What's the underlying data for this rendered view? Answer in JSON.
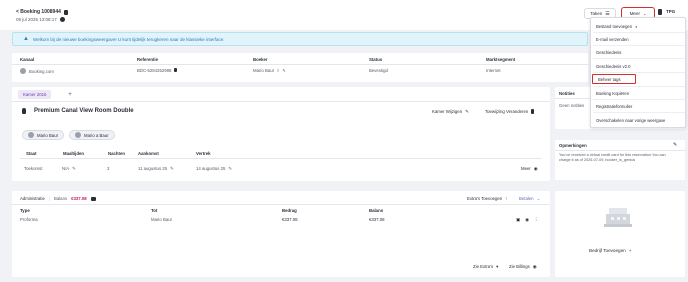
{
  "header": {
    "title": "< Boeking 1008944",
    "subtitle": "09 jul 2025 13:08:17",
    "taken_label": "Taken",
    "meer_label": "Meer",
    "tpg_label": "TPG"
  },
  "banner": {
    "text": "Welkom bij de nieuwe boekingsweergave! U kunt tijdelijk terugkeren naar de klassieke interface."
  },
  "overview": {
    "headers": [
      "Kanaal",
      "Referentie",
      "Boeker",
      "Status",
      "Marktsegment"
    ],
    "row": {
      "kanaal": "Booking.com",
      "referentie": "BDC-5284352988",
      "boeker": "Mario Baur",
      "status": "Bevestigd",
      "marktsegment": "Internet"
    }
  },
  "room": {
    "tab_label": "Kamer 2016",
    "add_tab": "+",
    "name": "Premium Canal View Room Double",
    "kamer_wijzigen": "Kamer Wijzigen",
    "toewijzing": "Toewijzing Veranderen",
    "guests": [
      "Mario Baur",
      "Mario a Baur"
    ],
    "headers": [
      "Staat",
      "Maaltijden",
      "Nachten",
      "Aankomst",
      "Vertrek"
    ],
    "row": {
      "staat": "Toekomst",
      "maaltijden": "N/A",
      "nachten": "3",
      "aankomst": "11 augustus 25",
      "vertrek": "14 augustus 25"
    },
    "meer_label": "Meer"
  },
  "admin": {
    "label": "Administratie",
    "balans_label": "Balans",
    "balans_value": "€337.08",
    "extras_label": "Extra's Toevoegen",
    "betalen_label": "Betalen",
    "headers": [
      "Type",
      "Tot",
      "Bedrag",
      "Balans"
    ],
    "row": {
      "type": "Proforma",
      "tot": "Mario Baur",
      "bedrag": "€337.08",
      "balans": "€337.08"
    },
    "footer_extras": "Zie Extra's",
    "footer_billings": "Zie Billings"
  },
  "side": {
    "notities_title": "Notities",
    "notities_body": "Geen notities",
    "opmerkingen_title": "Opmerkingen",
    "opmerkingen_body": "You've received a virtual credit card for this reservation.You can charge it as of 2025-07-09, booker_is_genius",
    "bedrijf_label": "Bedrijf Toevoegen"
  },
  "dropdown": {
    "items": [
      "Bestand toevoegen",
      "E-mail verzenden",
      "Geschiedenis",
      "Geschiedenis v2.0",
      "Beheer tags",
      "Boeking Kopiëren",
      "Registratieformulier",
      "Overschakelen naar vorige weergave"
    ]
  },
  "colors": {
    "accent": "#d32f2f",
    "magenta": "#c2185b",
    "link": "#5c6bc0",
    "banner_bg": "#e1f3fb"
  }
}
